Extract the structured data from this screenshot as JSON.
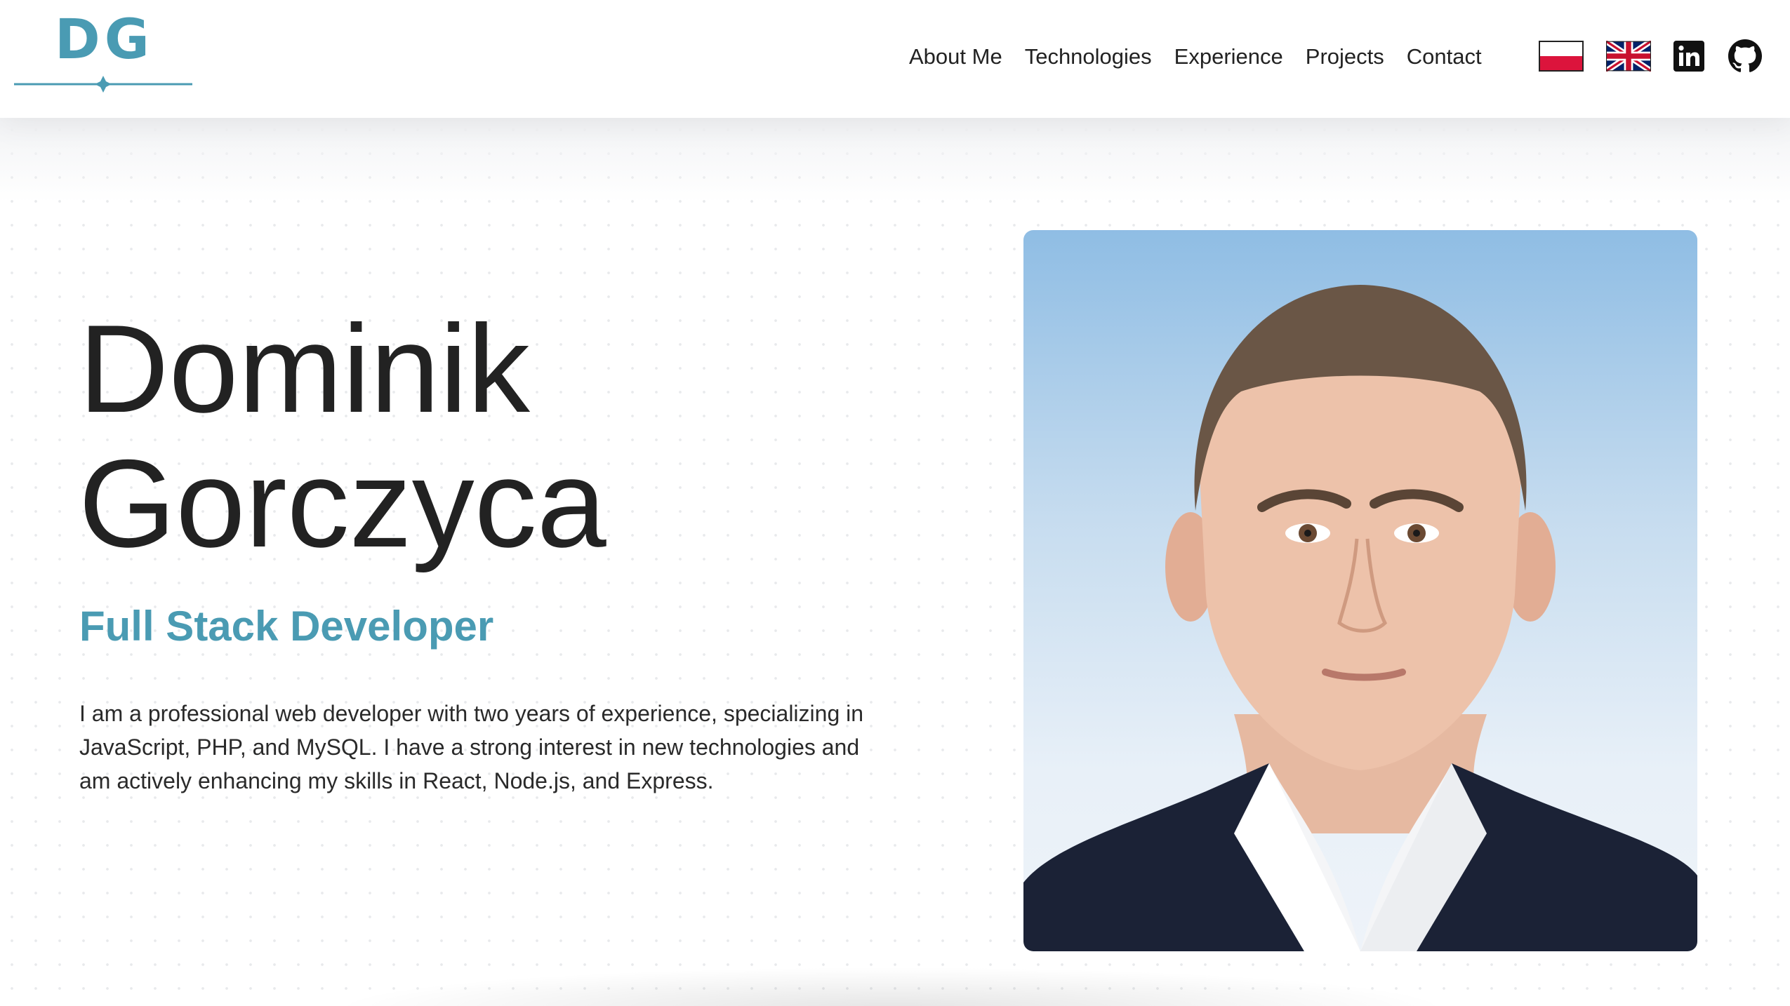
{
  "logo": {
    "text": "DG",
    "icon": "dg-monogram-logo"
  },
  "nav": {
    "items": [
      {
        "label": "About Me"
      },
      {
        "label": "Technologies"
      },
      {
        "label": "Experience"
      },
      {
        "label": "Projects"
      },
      {
        "label": "Contact"
      }
    ]
  },
  "header_icons": {
    "polish_flag": "polish-flag-icon",
    "uk_flag": "uk-flag-icon",
    "linkedin": "linkedin-icon",
    "github": "github-icon"
  },
  "hero": {
    "first_name": "Dominik",
    "last_name": "Gorczyca",
    "role": "Full Stack Developer",
    "bio": "I am a professional web developer with two years of experience, specializing in JavaScript, PHP, and MySQL. I have a strong interest in new technologies and am actively enhancing my skills in React, Node.js, and Express.",
    "photo": "profile-photo"
  },
  "colors": {
    "accent": "#4a9bb3",
    "text": "#222222",
    "photo_background": "#9cc4e6",
    "suit": "#1b2236",
    "linkedin": "#111111",
    "github": "#111111",
    "flag_red": "#dc143c",
    "flag_blue": "#012169",
    "flag_cross_red": "#c8102e"
  }
}
